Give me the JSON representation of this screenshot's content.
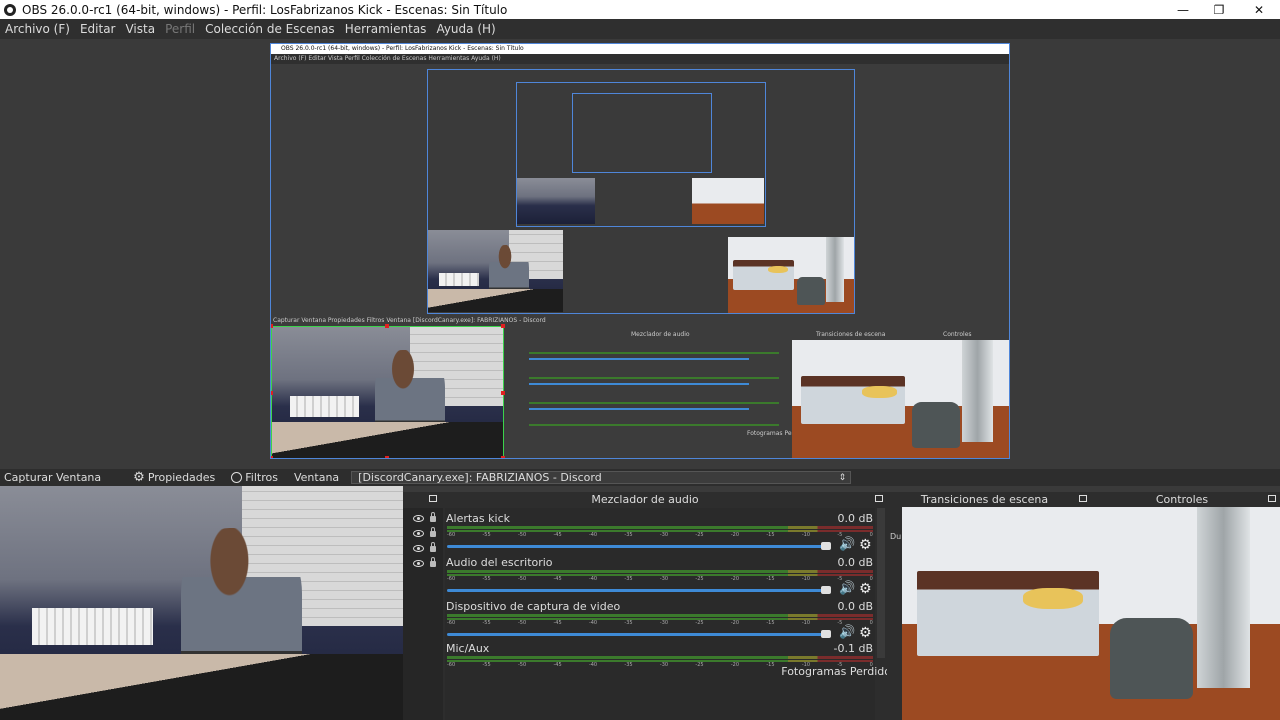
{
  "window": {
    "title": "OBS 26.0.0-rc1 (64-bit, windows) - Perfil: LosFabrizanos Kick - Escenas: Sin Título",
    "minimize": "—",
    "maximize": "❐",
    "close": "✕"
  },
  "menu": [
    {
      "label": "Archivo (F)",
      "disabled": false
    },
    {
      "label": "Editar",
      "disabled": false
    },
    {
      "label": "Vista",
      "disabled": false
    },
    {
      "label": "Perfil",
      "disabled": true
    },
    {
      "label": "Colección de Escenas",
      "disabled": false
    },
    {
      "label": "Herramientas",
      "disabled": false
    },
    {
      "label": "Ayuda (H)",
      "disabled": false
    }
  ],
  "preview": {
    "inner_title": "OBS 26.0.0-rc1 (64-bit, windows) - Perfil: LosFabrizanos Kick - Escenas: Sin Título",
    "inner_menu": "Archivo (F)   Editar   Vista   Perfil   Colección de Escenas   Herramientas   Ayuda (H)",
    "inner_src": "Capturar Ventana     Propiedades    Filtros    Ventana    [DiscordCanary.exe]: FABRIZIANOS - Discord",
    "inner_mixer": "Mezclador de audio",
    "inner_trans": "Transiciones de escena",
    "inner_ctrl": "Controles",
    "inner_frames": "Fotogramas Perdidos"
  },
  "source_toolbar": {
    "source": "Capturar Ventana",
    "properties": "Propiedades",
    "filters": "Filtros",
    "window_label": "Ventana",
    "window_value": "[DiscordCanary.exe]: FABRIZIANOS - Discord"
  },
  "mixer": {
    "title": "Mezclador de audio",
    "channels": [
      {
        "name": "Alertas kick",
        "db": "0.0 dB"
      },
      {
        "name": "Audio del escritorio",
        "db": "0.0 dB"
      },
      {
        "name": "Dispositivo de captura de video",
        "db": "0.0 dB"
      },
      {
        "name": "Mic/Aux",
        "db": "-0.1 dB"
      }
    ],
    "ticks": [
      "-60",
      "-55",
      "-50",
      "-45",
      "-40",
      "-35",
      "-30",
      "-25",
      "-20",
      "-15",
      "-10",
      "-5",
      "0"
    ],
    "frames_dropped": "Fotogramas Perdido"
  },
  "docks": {
    "transitions": "Transiciones de escena",
    "controls": "Controles",
    "partial": "Du"
  },
  "icons": {
    "gear": "⚙",
    "volume": "🔊",
    "eye": "eye-icon",
    "lock": "lock-icon"
  },
  "colors": {
    "selection": "#3bd34b",
    "preview_border": "#4f86d9",
    "slider": "#3e8ad6"
  }
}
